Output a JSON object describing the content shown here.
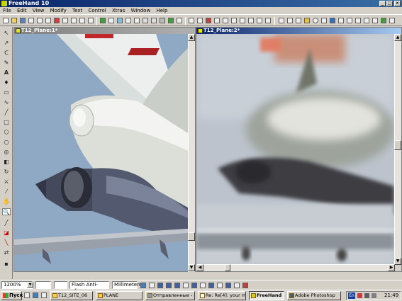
{
  "window": {
    "title": "FreeHand 10",
    "min": "_",
    "max": "□",
    "close": "×"
  },
  "menu": [
    "File",
    "Edit",
    "View",
    "Modify",
    "Text",
    "Control",
    "Xtras",
    "Window",
    "Help"
  ],
  "doc_left": {
    "title": "T12_Plane:1*"
  },
  "doc_right": {
    "title": "T12_Plane:2*"
  },
  "status": {
    "zoom": "1200%",
    "preview": "Flash Anti-alias",
    "units": "Millimeters"
  },
  "taskbar": {
    "start": "Пуск",
    "items": [
      "T12_SITE_06",
      "PLANE",
      "Отправленные - Ou...",
      "Re: Re[4]: your mail",
      "FreeHand 10",
      "Adobe Photoshop"
    ],
    "lang": "En",
    "clock": "21:49"
  },
  "colors": {
    "title_active": "#0a246a",
    "sky": "#8fa9c4",
    "chrome": "#d4d0c8"
  }
}
